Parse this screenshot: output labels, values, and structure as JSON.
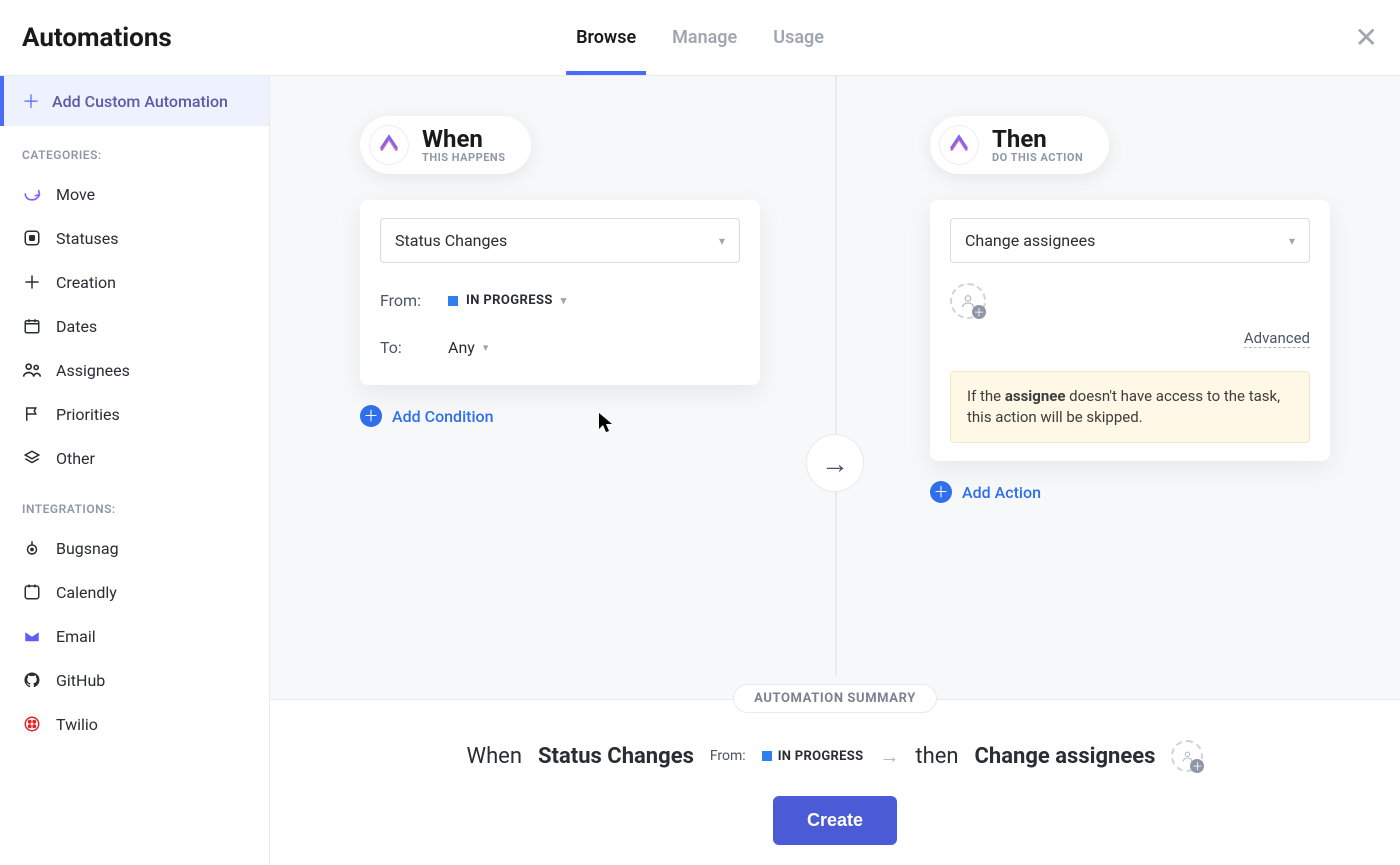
{
  "header": {
    "title": "Automations",
    "tabs": [
      {
        "label": "Browse",
        "active": true
      },
      {
        "label": "Manage",
        "active": false
      },
      {
        "label": "Usage",
        "active": false
      }
    ]
  },
  "sidebar": {
    "add_custom_label": "Add Custom Automation",
    "categories_label": "CATEGORIES:",
    "categories": [
      {
        "key": "move",
        "label": "Move"
      },
      {
        "key": "statuses",
        "label": "Statuses"
      },
      {
        "key": "creation",
        "label": "Creation"
      },
      {
        "key": "dates",
        "label": "Dates"
      },
      {
        "key": "assignees",
        "label": "Assignees"
      },
      {
        "key": "priorities",
        "label": "Priorities"
      },
      {
        "key": "other",
        "label": "Other"
      }
    ],
    "integrations_label": "INTEGRATIONS:",
    "integrations": [
      {
        "key": "bugsnag",
        "label": "Bugsnag"
      },
      {
        "key": "calendly",
        "label": "Calendly"
      },
      {
        "key": "email",
        "label": "Email"
      },
      {
        "key": "github",
        "label": "GitHub"
      },
      {
        "key": "twilio",
        "label": "Twilio"
      }
    ]
  },
  "builder": {
    "when": {
      "title": "When",
      "subtitle": "THIS HAPPENS",
      "trigger_label": "Status Changes",
      "from_label": "From:",
      "from_value": "IN PROGRESS",
      "from_color": "#2f80ed",
      "to_label": "To:",
      "to_value": "Any",
      "add_condition_label": "Add Condition"
    },
    "then": {
      "title": "Then",
      "subtitle": "DO THIS ACTION",
      "action_label": "Change assignees",
      "advanced_label": "Advanced",
      "warning_prefix": "If the ",
      "warning_bold": "assignee",
      "warning_suffix": " doesn't have access to the task, this action will be skipped.",
      "add_action_label": "Add Action"
    }
  },
  "summary": {
    "heading": "AUTOMATION SUMMARY",
    "when_word": "When",
    "trigger": "Status Changes",
    "from_label": "From:",
    "from_value": "IN PROGRESS",
    "then_word": "then",
    "action": "Change assignees",
    "create_label": "Create"
  }
}
